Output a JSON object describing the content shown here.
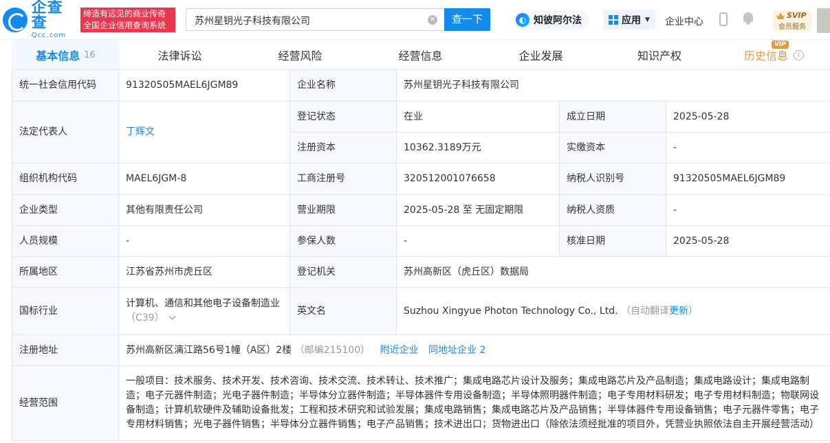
{
  "header": {
    "logo_cn": "企查查",
    "logo_en": "Qcc.com",
    "slogan_line1": "缔造有远见的商业传奇",
    "slogan_line2": "全国企业信用查询系统",
    "search_value": "苏州星钥光子科技有限公司",
    "search_button": "查一下",
    "ai_label": "知彼阿尔法",
    "app_label": "应用",
    "enterprise_center": "企业中心",
    "svip_top": "SVIP",
    "svip_bottom": "会员服务",
    "brand_color": "#128bed"
  },
  "tabs": [
    {
      "label": "基本信息",
      "count": "16"
    },
    {
      "label": "法律诉讼"
    },
    {
      "label": "经营风险"
    },
    {
      "label": "经营信息"
    },
    {
      "label": "企业发展"
    },
    {
      "label": "知识产权"
    },
    {
      "label": "历史信息",
      "badge": "VIP"
    }
  ],
  "info": {
    "credit_code_label": "统一社会信用代码",
    "credit_code": "91320505MAEL6JGM89",
    "company_name_label": "企业名称",
    "company_name": "苏州星钥光子科技有限公司",
    "legal_rep_label": "法定代表人",
    "legal_rep": "丁辉文",
    "status_label": "登记状态",
    "status": "在业",
    "found_date_label": "成立日期",
    "found_date": "2025-05-28",
    "reg_capital_label": "注册资本",
    "reg_capital": "10362.3189万元",
    "paid_capital_label": "实缴资本",
    "paid_capital": "-",
    "org_code_label": "组织机构代码",
    "org_code": "MAEL6JGM-8",
    "biz_reg_no_label": "工商注册号",
    "biz_reg_no": "320512001076658",
    "taxpayer_id_label": "纳税人识别号",
    "taxpayer_id": "91320505MAEL6JGM89",
    "type_label": "企业类型",
    "type": "其他有限责任公司",
    "term_label": "营业期限",
    "term": "2025-05-28 至 无固定期限",
    "taxpayer_qual_label": "纳税人资质",
    "taxpayer_qual": "-",
    "staff_label": "人员规模",
    "staff": "-",
    "insured_label": "参保人数",
    "insured": "-",
    "approve_date_label": "核准日期",
    "approve_date": "2025-05-28",
    "region_label": "所属地区",
    "region": "江苏省苏州市虎丘区",
    "authority_label": "登记机关",
    "authority": "苏州高新区（虎丘区）数据局",
    "industry_label": "国标行业",
    "industry": "计算机、通信和其他电子设备制造业",
    "industry_code": "（C39）",
    "english_name_label": "英文名",
    "english_name": "Suzhou Xingyue Photon Technology Co., Ltd.",
    "auto_translate": "（自动翻译",
    "update_link": "更新",
    "auto_translate_end": "）",
    "address_label": "注册地址",
    "address": "苏州高新区漓江路56号1幢（A区）2楼",
    "postcode": "（邮编215100）",
    "nearby_link": "附近企业",
    "same_address_link": "同地址企业 2",
    "scope_label": "经营范围",
    "scope": "一般项目：技术服务、技术开发、技术咨询、技术交流、技术转让、技术推广；集成电路芯片设计及服务；集成电路芯片及产品制造；集成电路设计；集成电路制造；电子元器件制造；光电子器件制造；半导体分立器件制造；半导体器件专用设备制造；半导体照明器件制造；电子专用材料研发；电子专用材料制造；物联网设备制造；计算机软硬件及辅助设备批发；工程和技术研究和试验发展；集成电路销售；集成电路芯片及产品销售；半导体器件专用设备销售；电子元器件零售；电子专用材料销售；光电子器件销售；半导体分立器件销售；电子产品销售；技术进出口；货物进出口（除依法须经批准的项目外，凭营业执照依法自主开展经营活动）"
  }
}
